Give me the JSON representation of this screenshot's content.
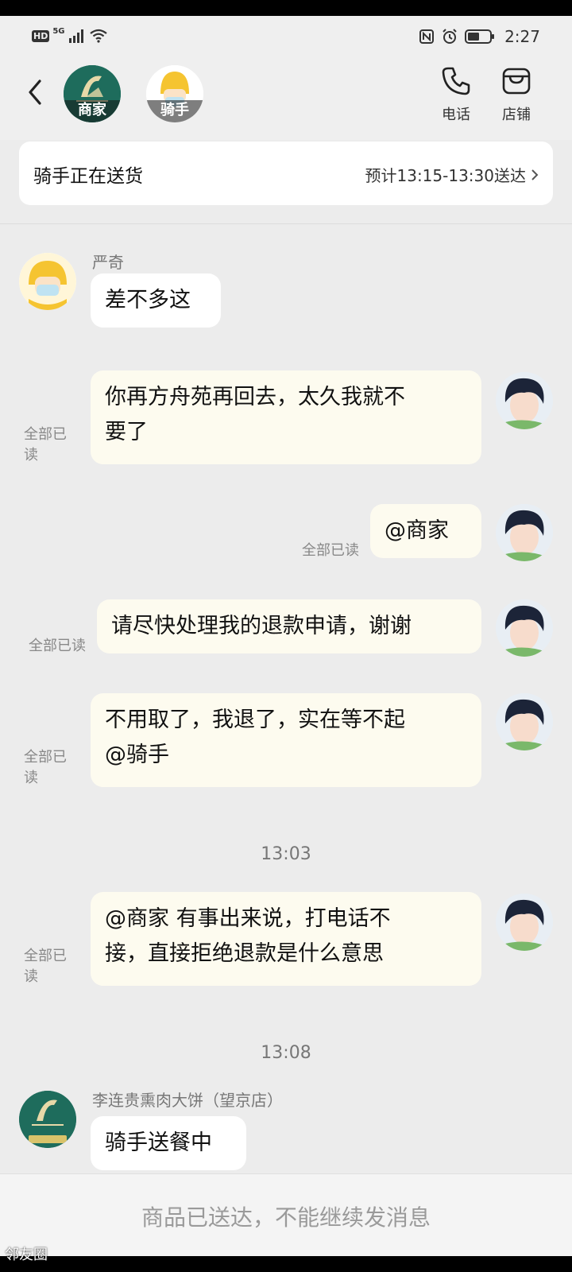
{
  "status_bar": {
    "network": "HD",
    "network_type": "5G",
    "time": "2:27",
    "icons": [
      "signal-icon",
      "wifi-icon",
      "nfc-icon",
      "alarm-icon",
      "battery-icon"
    ]
  },
  "header": {
    "merchant_avatar_label": "商家",
    "rider_avatar_label": "骑手",
    "phone_label": "电话",
    "store_label": "店铺"
  },
  "delivery": {
    "status": "骑手正在送货",
    "eta": "预计13:15-13:30送达"
  },
  "messages": [
    {
      "sender": "严奇",
      "text": "差不多这"
    },
    {
      "text_line1": "你再方舟苑再回去，太久我就不",
      "text_line2": "要了",
      "read_line1": "全部已",
      "read_line2": "读"
    },
    {
      "text": "@商家",
      "read": "全部已读"
    },
    {
      "text": "请尽快处理我的退款申请，谢谢",
      "read": "全部已读"
    },
    {
      "text_line1": "不用取了，我退了，实在等不起",
      "text_line2": "@骑手",
      "read_line1": "全部已",
      "read_line2": "读"
    },
    {
      "time": "13:03"
    },
    {
      "text_line1": "@商家 有事出来说，打电话不",
      "text_line2": "接，直接拒绝退款是什么意思",
      "read_line1": "全部已",
      "read_line2": "读"
    },
    {
      "time": "13:08"
    },
    {
      "sender": "李连贵熏肉大饼（望京店）",
      "text": "骑手送餐中"
    }
  ],
  "footer": {
    "notice": "商品已送达，不能继续发消息"
  },
  "watermark": "邻友圈",
  "colors": {
    "background": "#ececec",
    "incoming_bubble": "#ffffff",
    "outgoing_bubble": "#fdfbef",
    "merchant_green": "#1e6c5c",
    "rider_yellow": "#f5c431"
  }
}
